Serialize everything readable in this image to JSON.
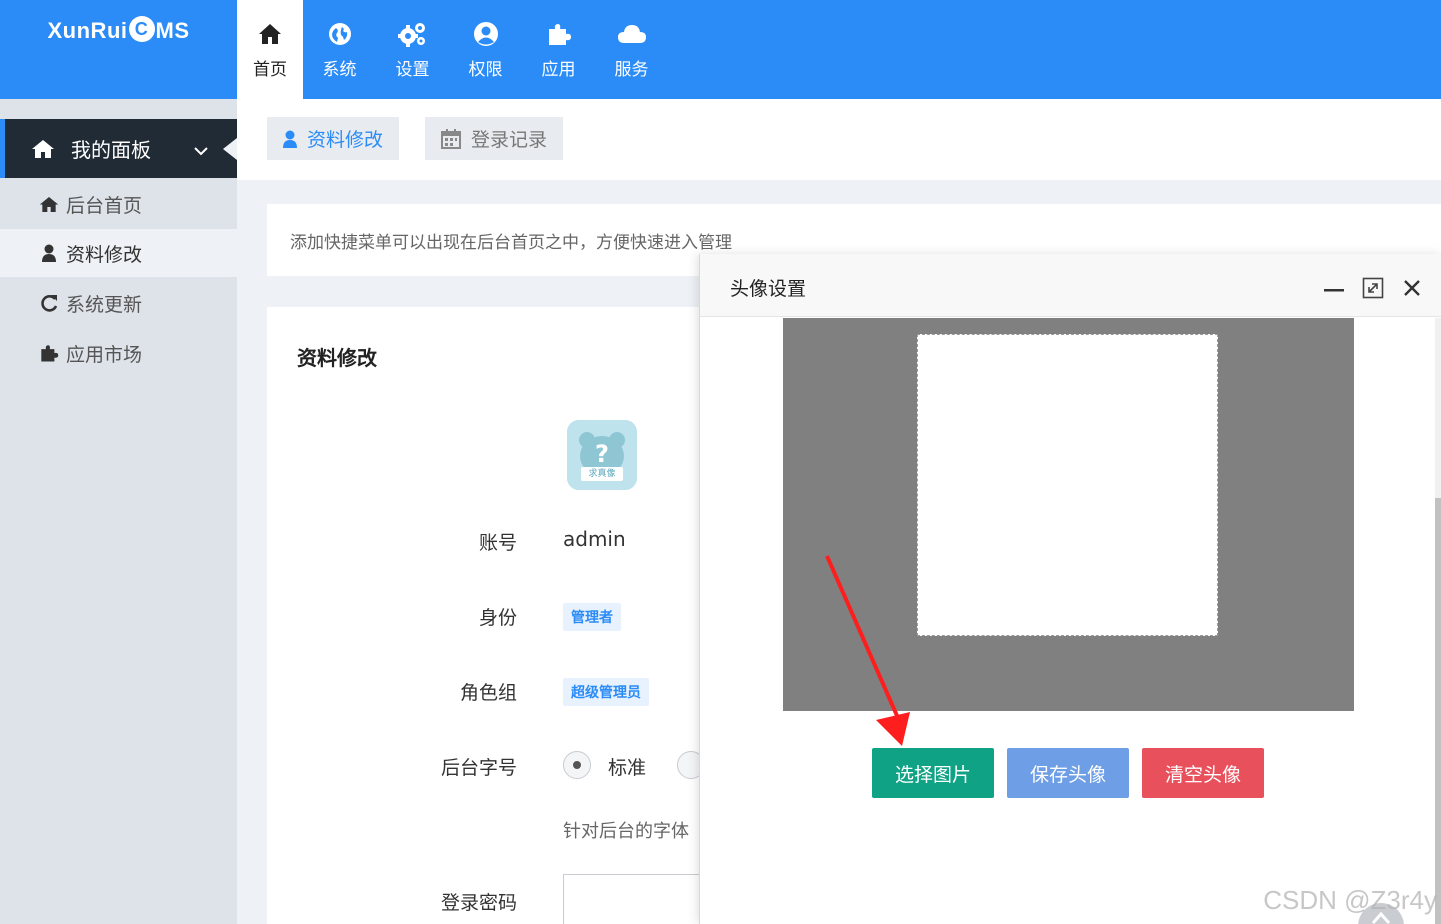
{
  "logo": {
    "text_left": "XunRui",
    "text_right": "MS",
    "flame_letter": "C"
  },
  "topnav": [
    {
      "label": "首页",
      "icon": "home-icon",
      "active": true
    },
    {
      "label": "系统",
      "icon": "globe-icon"
    },
    {
      "label": "设置",
      "icon": "gears-icon"
    },
    {
      "label": "权限",
      "icon": "user-circle-icon"
    },
    {
      "label": "应用",
      "icon": "puzzle-icon"
    },
    {
      "label": "服务",
      "icon": "cloud-icon"
    }
  ],
  "sidebar": {
    "header": "我的面板",
    "items": [
      {
        "label": "后台首页",
        "icon": "home-icon"
      },
      {
        "label": "资料修改",
        "icon": "user-icon",
        "active": true
      },
      {
        "label": "系统更新",
        "icon": "refresh-icon"
      },
      {
        "label": "应用市场",
        "icon": "puzzle-icon"
      }
    ]
  },
  "tabs": [
    {
      "label": "资料修改",
      "icon": "user-icon",
      "active": true
    },
    {
      "label": "登录记录",
      "icon": "calendar-icon"
    }
  ],
  "notice": "添加快捷菜单可以出现在后台首页之中，方便快速进入管理",
  "profile": {
    "title": "资料修改",
    "avatar_text": "求真像",
    "account_label": "账号",
    "account_value": "admin",
    "identity_label": "身份",
    "identity_badge": "管理者",
    "role_label": "角色组",
    "role_badge": "超级管理员",
    "fontsize_label": "后台字号",
    "fontsize_option": "标准",
    "fontsize_help": "针对后台的字体",
    "password_label": "登录密码"
  },
  "modal": {
    "title": "头像设置",
    "btn_select": "选择图片",
    "btn_save": "保存头像",
    "btn_clear": "清空头像"
  },
  "colors": {
    "primary": "#2b8cf7",
    "sidebar_dark": "#212b35",
    "select_button": "#10a285",
    "save_button": "#6d9ee6",
    "clear_button": "#e8505b",
    "annotation_arrow": "#ff1e1e"
  },
  "watermark": "CSDN @Z3r4y"
}
